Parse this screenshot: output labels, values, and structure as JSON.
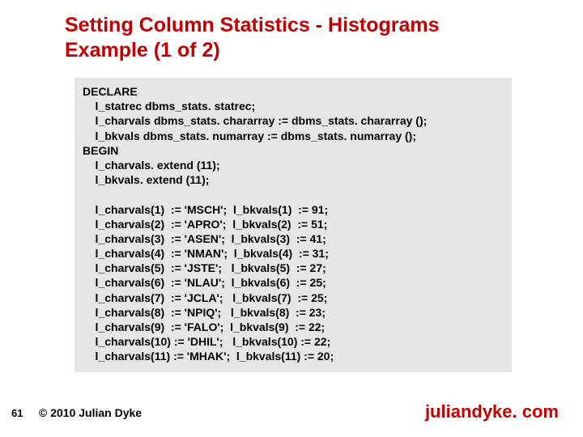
{
  "title_line1": "Setting Column Statistics - Histograms",
  "title_line2": "Example (1 of 2)",
  "code": "DECLARE\n    l_statrec dbms_stats. statrec;\n    l_charvals dbms_stats. chararray := dbms_stats. chararray ();\n    l_bkvals dbms_stats. numarray := dbms_stats. numarray ();\nBEGIN\n    l_charvals. extend (11);\n    l_bkvals. extend (11);\n\n    l_charvals(1)  := 'MSCH';  l_bkvals(1)  := 91;\n    l_charvals(2)  := 'APRO';  l_bkvals(2)  := 51;\n    l_charvals(3)  := 'ASEN';  l_bkvals(3)  := 41;\n    l_charvals(4)  := 'NMAN';  l_bkvals(4)  := 31;\n    l_charvals(5)  := 'JSTE';   l_bkvals(5)  := 27;\n    l_charvals(6)  := 'NLAU';  l_bkvals(6)  := 25;\n    l_charvals(7)  := 'JCLA';   l_bkvals(7)  := 25;\n    l_charvals(8)  := 'NPIQ';   l_bkvals(8)  := 23;\n    l_charvals(9)  := 'FALO';  l_bkvals(9)  := 22;\n    l_charvals(10) := 'DHIL';   l_bkvals(10) := 22;\n    l_charvals(11) := 'MHAK';  l_bkvals(11) := 20;",
  "page_number": "61",
  "copyright": "© 2010 Julian Dyke",
  "site": "juliandyke. com"
}
